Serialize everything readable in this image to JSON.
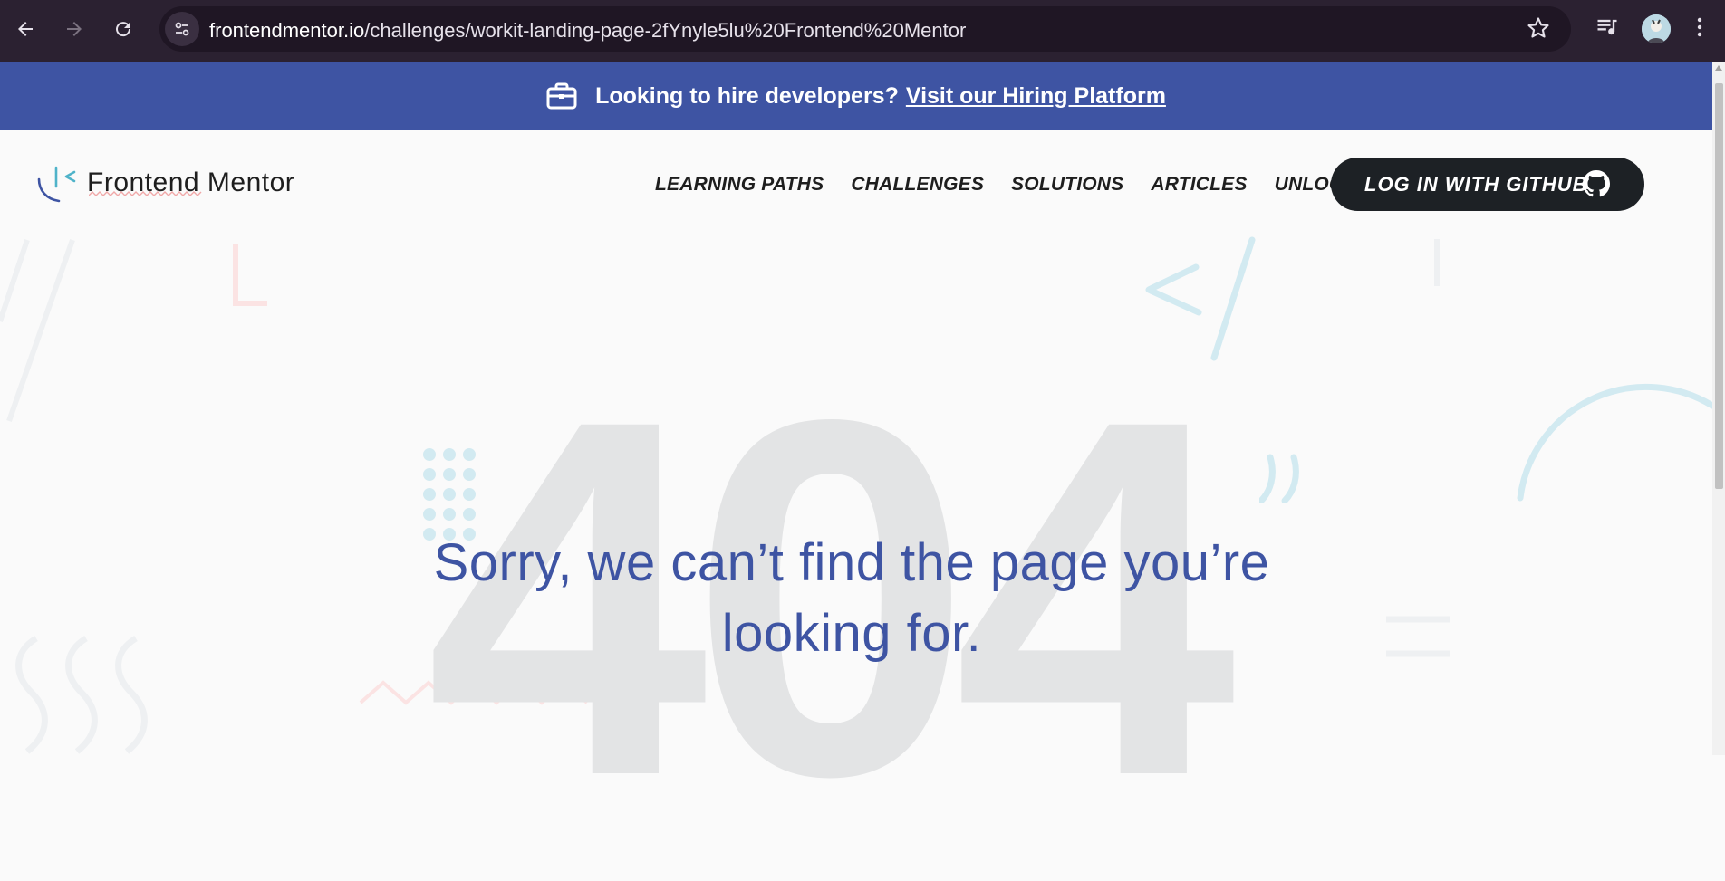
{
  "browser": {
    "url_host": "frontendmentor.io",
    "url_path": "/challenges/workit-landing-page-2fYnyle5lu%20Frontend%20Mentor"
  },
  "banner": {
    "text": "Looking to hire developers?",
    "link": "Visit our Hiring Platform"
  },
  "header": {
    "logo_text": "Frontend Mentor",
    "nav": [
      "LEARNING PATHS",
      "CHALLENGES",
      "SOLUTIONS",
      "ARTICLES",
      "UNLOCK PRO"
    ],
    "login_button": "LOG IN WITH GITHUB"
  },
  "main": {
    "big_number": "404",
    "message": "Sorry, we can’t find the page you’re looking for."
  },
  "colors": {
    "brand_blue": "#3e54a3",
    "dark": "#1d2125",
    "chrome_bg": "#2b2131"
  }
}
